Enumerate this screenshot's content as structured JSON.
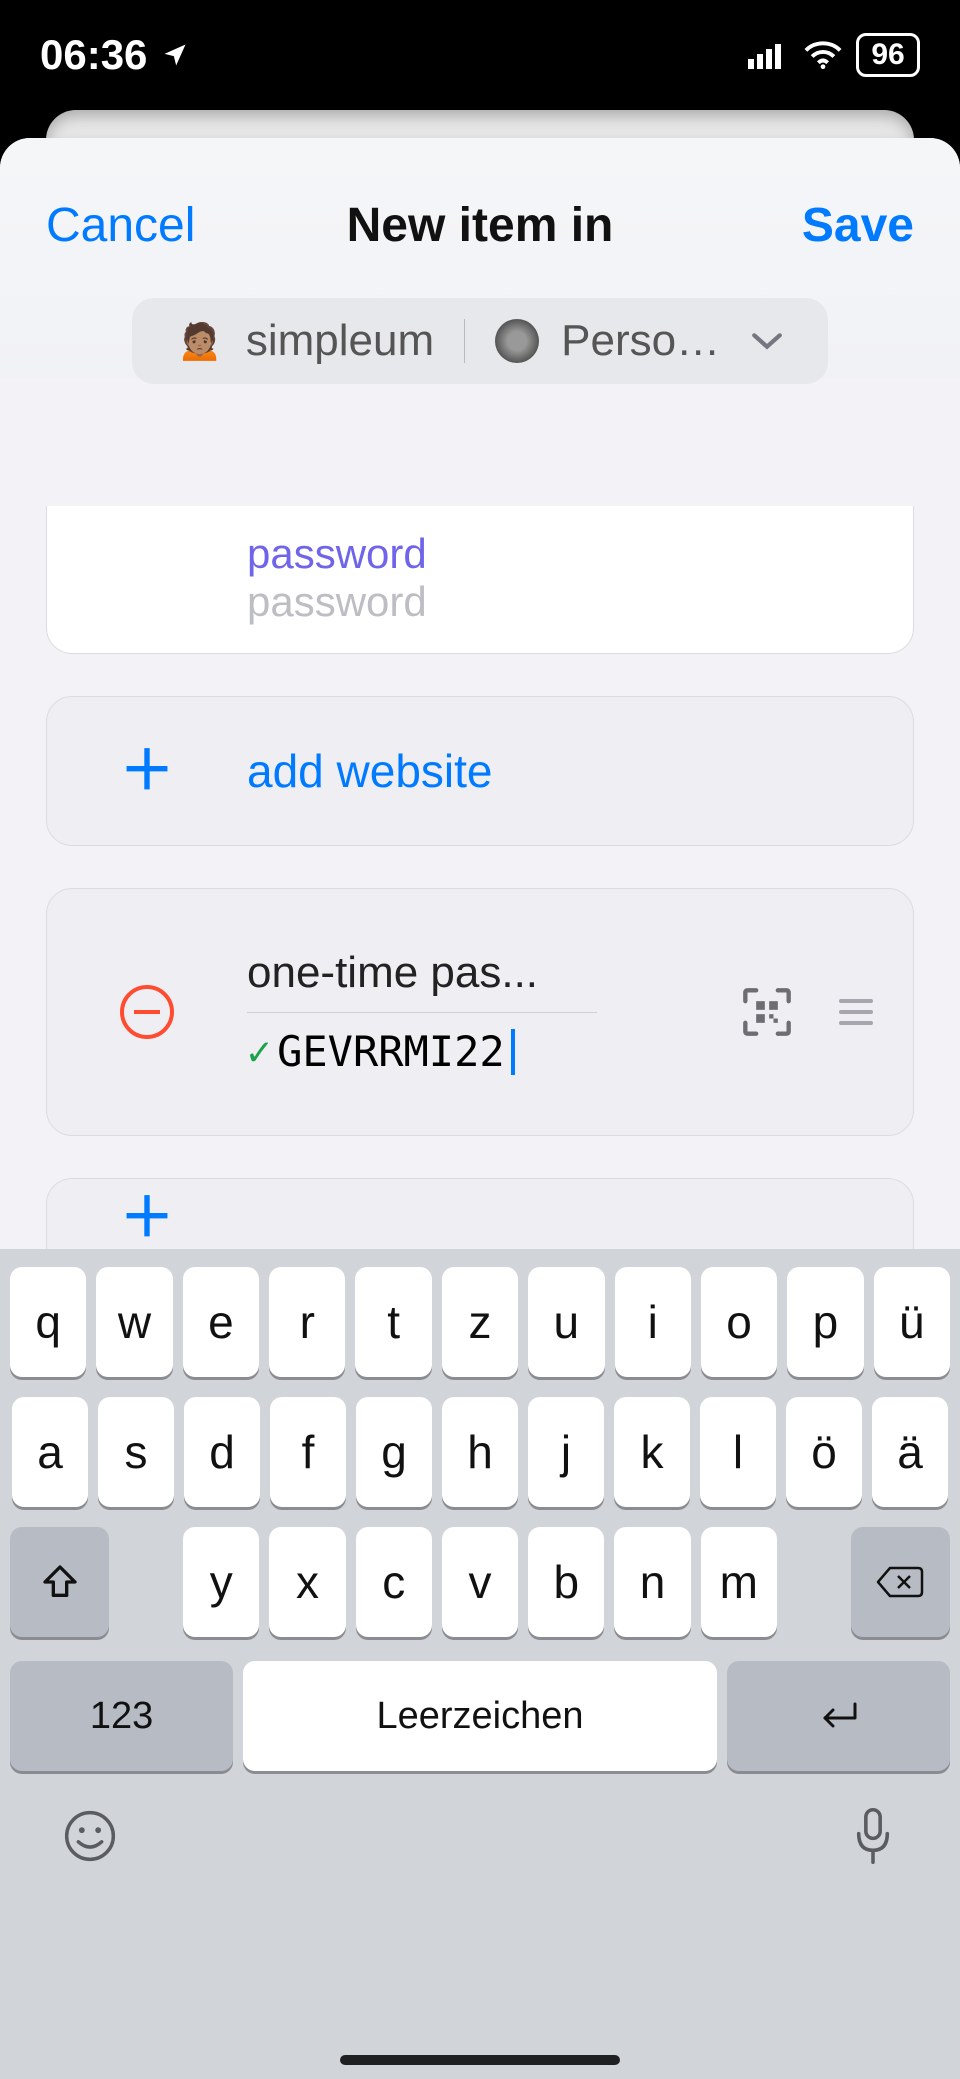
{
  "status": {
    "time": "06:36",
    "battery": "96"
  },
  "nav": {
    "cancel": "Cancel",
    "title": "New item in",
    "save": "Save"
  },
  "vault": {
    "user": "simpleum",
    "name": "Perso…"
  },
  "fields": {
    "password": {
      "label": "password",
      "placeholder": "password"
    },
    "add_website": "add website",
    "otp": {
      "label": "one-time pas...",
      "value": "GEVRRMI22"
    }
  },
  "keyboard": {
    "row1": [
      "q",
      "w",
      "e",
      "r",
      "t",
      "z",
      "u",
      "i",
      "o",
      "p",
      "ü"
    ],
    "row2": [
      "a",
      "s",
      "d",
      "f",
      "g",
      "h",
      "j",
      "k",
      "l",
      "ö",
      "ä"
    ],
    "row3": [
      "y",
      "x",
      "c",
      "v",
      "b",
      "n",
      "m"
    ],
    "num": "123",
    "space": "Leerzeichen"
  }
}
